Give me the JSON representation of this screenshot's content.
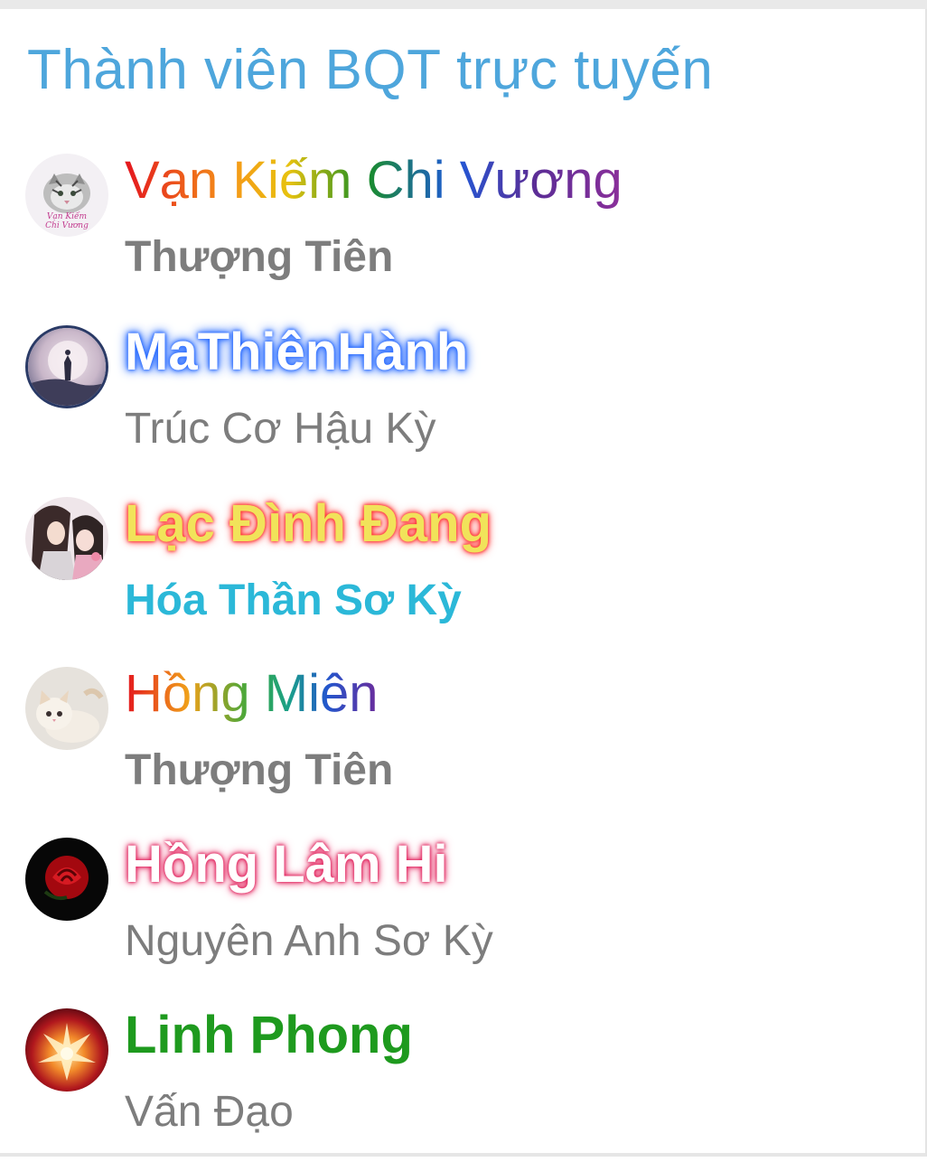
{
  "panel": {
    "title": "Thành viên BQT trực tuyến"
  },
  "members": [
    {
      "name": "Vạn Kiếm Chi Vương",
      "rank": "Thượng Tiên",
      "avatar": "tiger-avatar",
      "avatar_text_1": "Vạn Kiếm",
      "avatar_text_2": "Chi Vương"
    },
    {
      "name": "MaThiênHành",
      "rank": "Trúc Cơ Hậu Kỳ",
      "avatar": "moon-figure-avatar"
    },
    {
      "name": "Lạc Đình Đang",
      "rank": "Hóa Thần Sơ Kỳ",
      "avatar": "couple-art-avatar"
    },
    {
      "name": "Hồng Miên",
      "rank": "Thượng Tiên",
      "avatar": "kitten-avatar"
    },
    {
      "name": "Hồng Lâm Hi",
      "rank": "Nguyên Anh Sơ Kỳ",
      "avatar": "red-rose-avatar"
    },
    {
      "name": "Linh Phong",
      "rank": "Vấn Đạo",
      "avatar": "phoenix-emblem-avatar"
    }
  ],
  "colors": {
    "title": "#4ea6dc",
    "rank_default": "#7d7d7d",
    "rank_cyan": "#2bb8d8",
    "name_green": "#1e9a1e",
    "glow_blue": "#2b6cff",
    "glow_red": "#ff2f2f",
    "glow_pink": "#e0245e"
  }
}
